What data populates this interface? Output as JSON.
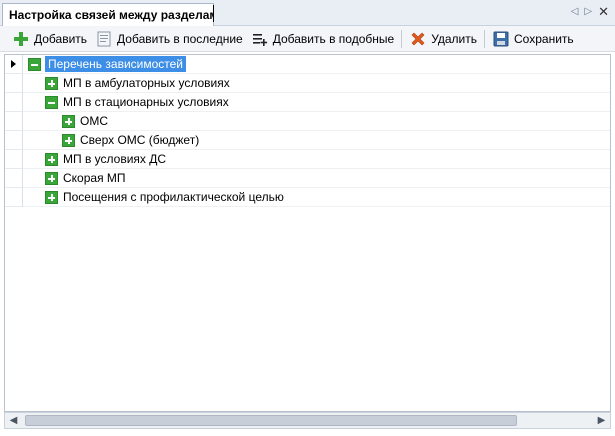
{
  "window": {
    "title": "Настройка связей между разделами",
    "controls": {
      "prev": "◁",
      "next": "▷",
      "close": "✕"
    }
  },
  "toolbar": {
    "add_label": "Добавить",
    "add_to_last_label": "Добавить в последние",
    "add_to_similar_label": "Добавить в подобные",
    "delete_label": "Удалить",
    "save_label": "Сохранить"
  },
  "tree": {
    "rows": [
      {
        "label": "Перечень зависимостей",
        "level": 0,
        "state": "expanded",
        "selected": true,
        "current": true
      },
      {
        "label": "МП в амбулаторных условиях",
        "level": 1,
        "state": "collapsed"
      },
      {
        "label": "МП в стационарных условиях",
        "level": 1,
        "state": "expanded"
      },
      {
        "label": "ОМС",
        "level": 2,
        "state": "collapsed"
      },
      {
        "label": "Сверх ОМС (бюджет)",
        "level": 2,
        "state": "collapsed"
      },
      {
        "label": "МП в условиях ДС",
        "level": 1,
        "state": "collapsed"
      },
      {
        "label": "Скорая МП",
        "level": 1,
        "state": "collapsed"
      },
      {
        "label": "Посещения с профилактической целью",
        "level": 1,
        "state": "collapsed"
      }
    ]
  },
  "scrollbar": {
    "left_arrow": "◀",
    "right_arrow": "▶"
  },
  "colors": {
    "selection": "#3d8ee6",
    "expander": "#3aa63a",
    "toolbar_bg": "#f3f5f9",
    "titlebar_bg": "#e9eef5"
  }
}
